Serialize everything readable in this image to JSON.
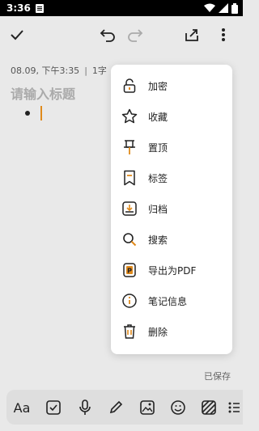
{
  "status_bar": {
    "time": "3:36"
  },
  "toolbar": {
    "confirm_icon": "check-icon",
    "undo_icon": "undo-icon",
    "redo_icon": "redo-icon",
    "share_icon": "share-icon",
    "more_icon": "more-vertical-icon"
  },
  "note": {
    "date": "08.09, 下午3:35",
    "separator": "|",
    "word_count": "1字",
    "title_placeholder": "请输入标题",
    "saved_status": "已保存"
  },
  "menu": {
    "items": [
      {
        "label": "加密",
        "icon": "lock-icon"
      },
      {
        "label": "收藏",
        "icon": "star-icon"
      },
      {
        "label": "置顶",
        "icon": "pin-icon"
      },
      {
        "label": "标签",
        "icon": "tag-icon"
      },
      {
        "label": "归档",
        "icon": "archive-icon"
      },
      {
        "label": "搜索",
        "icon": "search-icon"
      },
      {
        "label": "导出为PDF",
        "icon": "pdf-icon"
      },
      {
        "label": "笔记信息",
        "icon": "info-icon"
      },
      {
        "label": "删除",
        "icon": "trash-icon"
      }
    ]
  },
  "bottom_bar": {
    "text_format_label": "Aa",
    "icons": [
      "text-format-icon",
      "checkbox-icon",
      "microphone-icon",
      "pen-icon",
      "image-icon",
      "emoji-icon",
      "background-icon",
      "list-icon"
    ]
  },
  "colors": {
    "accent": "#e08a1c",
    "background": "#e9e9e9",
    "menu_bg": "#ffffff"
  }
}
